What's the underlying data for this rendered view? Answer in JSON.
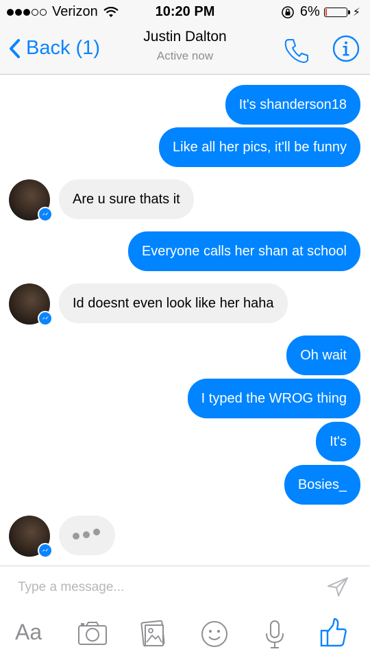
{
  "status_bar": {
    "carrier": "Verizon",
    "time": "10:20 PM",
    "battery": "6%",
    "battery_level": 0.06
  },
  "header": {
    "back_label": "Back (1)",
    "contact_name": "Justin Dalton",
    "status": "Active now",
    "icons": [
      "back-chevron-icon",
      "phone-icon",
      "info-icon"
    ]
  },
  "messages": [
    {
      "from": "me",
      "text": "It's shanderson18"
    },
    {
      "from": "me",
      "text": "Like all her pics, it'll be funny"
    },
    {
      "from": "them",
      "text": "Are u sure thats it"
    },
    {
      "from": "me",
      "text": "Everyone calls her shan at school"
    },
    {
      "from": "them",
      "text": "Id doesnt even look like her haha"
    },
    {
      "from": "me",
      "text": "Oh wait"
    },
    {
      "from": "me",
      "text": "I typed the WROG thing"
    },
    {
      "from": "me",
      "text": "It's"
    },
    {
      "from": "me",
      "text": "Bosies_"
    }
  ],
  "composer": {
    "placeholder": "Type a message...",
    "text_button": "Aa",
    "icons": [
      "send-icon",
      "camera-icon",
      "photo-icon",
      "emoji-icon",
      "microphone-icon",
      "thumbs-up-icon"
    ]
  },
  "colors": {
    "accent": "#0084ff",
    "incoming_bubble": "#f1f0f0",
    "battery_low": "#ff3b30"
  }
}
